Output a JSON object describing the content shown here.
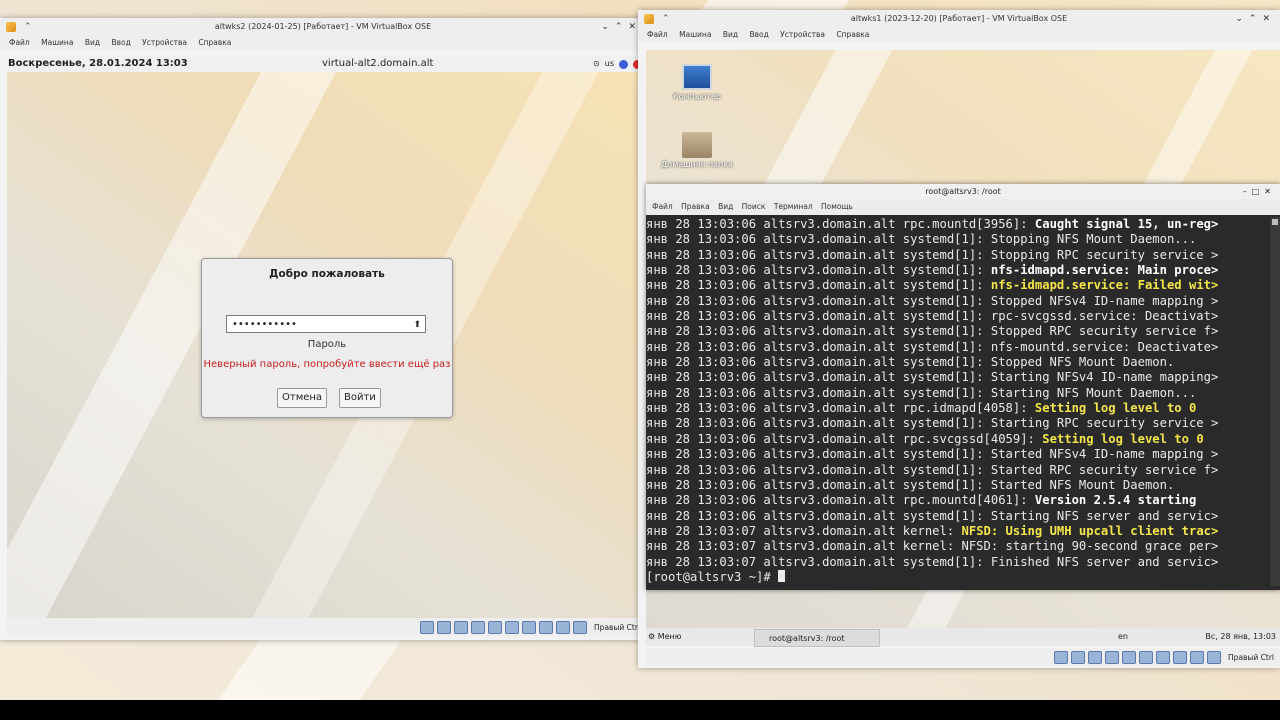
{
  "vm_left": {
    "title": "altwks2 (2024-01-25) [Работает] - VM VirtualBox OSE",
    "menu": [
      "Файл",
      "Машина",
      "Вид",
      "Ввод",
      "Устройства",
      "Справка"
    ],
    "guest_clock": "Воскресенье, 28.01.2024 13:03",
    "guest_host": "virtual-alt2.domain.alt",
    "keyboard_layout": "us",
    "login": {
      "welcome": "Добро пожаловать",
      "password_value": "•••••••••••",
      "password_label": "Пароль",
      "error": "Неверный пароль, попробуйте ввести ещё раз",
      "cancel": "Отмена",
      "login": "Войти"
    },
    "host_key": "Правый Ctrl"
  },
  "vm_right": {
    "title": "altwks1 (2023-12-20) [Работает] - VM VirtualBox OSE",
    "menu": [
      "Файл",
      "Машина",
      "Вид",
      "Ввод",
      "Устройства",
      "Справка"
    ],
    "desktop_icons": [
      "Компьютер",
      "Домашняя папка"
    ],
    "terminal": {
      "title": "root@altsrv3: /root",
      "menu": [
        "Файл",
        "Правка",
        "Вид",
        "Поиск",
        "Терминал",
        "Помощь"
      ],
      "lines": [
        {
          "t": "янв 28 13:03:06 altsrv3.domain.alt rpc.mountd[3956]: ",
          "h": "Caught signal 15, un-reg>",
          "s": "b"
        },
        {
          "t": "янв 28 13:03:06 altsrv3.domain.alt systemd[1]: Stopping NFS Mount Daemon...",
          "h": "",
          "s": ""
        },
        {
          "t": "янв 28 13:03:06 altsrv3.domain.alt systemd[1]: Stopping RPC security service >",
          "h": "",
          "s": ""
        },
        {
          "t": "янв 28 13:03:06 altsrv3.domain.alt systemd[1]: ",
          "h": "nfs-idmapd.service: Main proce>",
          "s": "b"
        },
        {
          "t": "янв 28 13:03:06 altsrv3.domain.alt systemd[1]: ",
          "h": "nfs-idmapd.service: Failed wit>",
          "s": "y"
        },
        {
          "t": "янв 28 13:03:06 altsrv3.domain.alt systemd[1]: Stopped NFSv4 ID-name mapping >",
          "h": "",
          "s": ""
        },
        {
          "t": "янв 28 13:03:06 altsrv3.domain.alt systemd[1]: rpc-svcgssd.service: Deactivat>",
          "h": "",
          "s": ""
        },
        {
          "t": "янв 28 13:03:06 altsrv3.domain.alt systemd[1]: Stopped RPC security service f>",
          "h": "",
          "s": ""
        },
        {
          "t": "янв 28 13:03:06 altsrv3.domain.alt systemd[1]: nfs-mountd.service: Deactivate>",
          "h": "",
          "s": ""
        },
        {
          "t": "янв 28 13:03:06 altsrv3.domain.alt systemd[1]: Stopped NFS Mount Daemon.",
          "h": "",
          "s": ""
        },
        {
          "t": "янв 28 13:03:06 altsrv3.domain.alt systemd[1]: Starting NFSv4 ID-name mapping>",
          "h": "",
          "s": ""
        },
        {
          "t": "янв 28 13:03:06 altsrv3.domain.alt systemd[1]: Starting NFS Mount Daemon...",
          "h": "",
          "s": ""
        },
        {
          "t": "янв 28 13:03:06 altsrv3.domain.alt rpc.idmapd[4058]: ",
          "h": "Setting log level to 0",
          "s": "y"
        },
        {
          "t": "янв 28 13:03:06 altsrv3.domain.alt systemd[1]: Starting RPC security service >",
          "h": "",
          "s": ""
        },
        {
          "t": "янв 28 13:03:06 altsrv3.domain.alt rpc.svcgssd[4059]: ",
          "h": "Setting log level to 0",
          "s": "y"
        },
        {
          "t": "янв 28 13:03:06 altsrv3.domain.alt systemd[1]: Started NFSv4 ID-name mapping >",
          "h": "",
          "s": ""
        },
        {
          "t": "янв 28 13:03:06 altsrv3.domain.alt systemd[1]: Started RPC security service f>",
          "h": "",
          "s": ""
        },
        {
          "t": "янв 28 13:03:06 altsrv3.domain.alt systemd[1]: Started NFS Mount Daemon.",
          "h": "",
          "s": ""
        },
        {
          "t": "янв 28 13:03:06 altsrv3.domain.alt rpc.mountd[4061]: ",
          "h": "Version 2.5.4 starting",
          "s": "b"
        },
        {
          "t": "янв 28 13:03:06 altsrv3.domain.alt systemd[1]: Starting NFS server and servic>",
          "h": "",
          "s": ""
        },
        {
          "t": "янв 28 13:03:07 altsrv3.domain.alt kernel: ",
          "h": "NFSD: Using UMH upcall client trac>",
          "s": "y"
        },
        {
          "t": "янв 28 13:03:07 altsrv3.domain.alt kernel: NFSD: starting 90-second grace per>",
          "h": "",
          "s": ""
        },
        {
          "t": "янв 28 13:03:07 altsrv3.domain.alt systemd[1]: Finished NFS server and servic>",
          "h": "",
          "s": ""
        }
      ],
      "prompt": "[root@altsrv3 ~]# "
    },
    "taskbar": {
      "menu": "Меню",
      "task": "root@altsrv3: /root",
      "lang": "en",
      "clock": "Вс, 28 янв, 13:03"
    },
    "host_key": "Правый Ctrl"
  },
  "colors": {
    "error": "#c81d1d",
    "term_bg": "#2a2a2a",
    "term_highlight": "#f3e54a"
  }
}
